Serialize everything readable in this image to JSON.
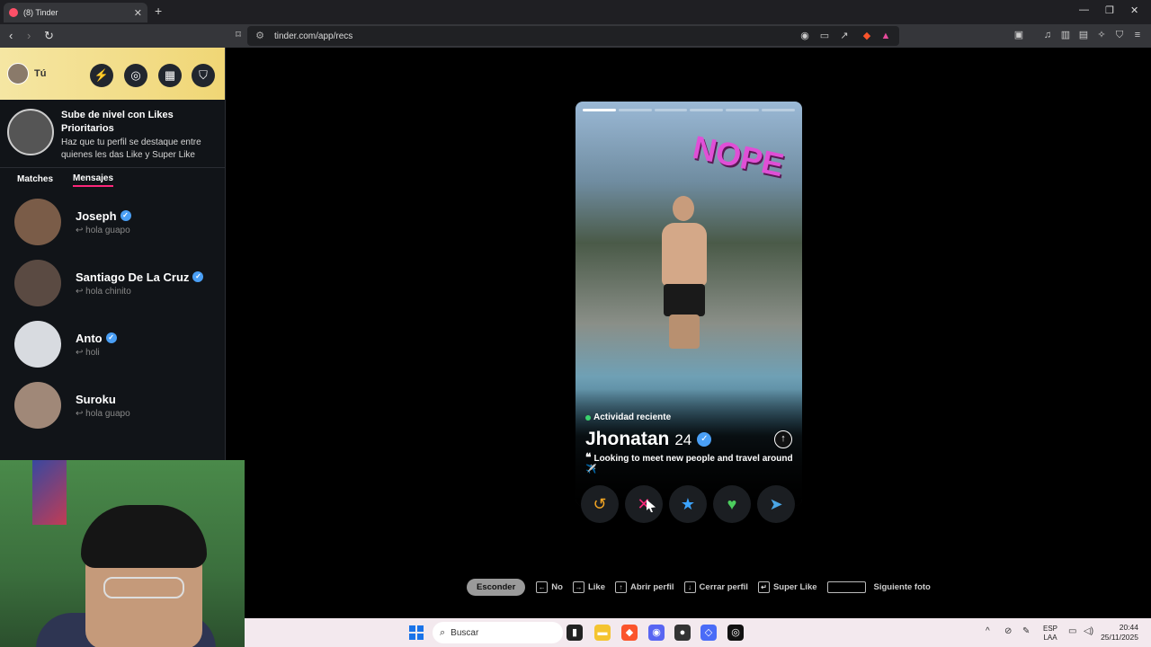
{
  "browser": {
    "tab_title": "(8) Tinder",
    "tab_close": "✕",
    "new_tab": "+",
    "url": "tinder.com/app/recs",
    "window_controls": [
      "—",
      "❐",
      "✕"
    ]
  },
  "sidebar": {
    "user_label": "Tú",
    "header_buttons": [
      "boost-icon",
      "explore-icon",
      "briefcase-icon",
      "shield-icon"
    ],
    "promo": {
      "title": "Sube de nivel con Likes Prioritarios",
      "description": "Haz que tu perfil se destaque entre quienes les das Like y Super Like"
    },
    "tabs": [
      {
        "label": "Matches",
        "active": false
      },
      {
        "label": "Mensajes",
        "active": true
      }
    ],
    "messages": [
      {
        "name": "Joseph",
        "verified": true,
        "preview": "hola guapo"
      },
      {
        "name": "Santiago De La Cruz",
        "verified": true,
        "preview": "hola chinito"
      },
      {
        "name": "Anto",
        "verified": true,
        "preview": "holi"
      },
      {
        "name": "Suroku",
        "verified": false,
        "preview": "hola guapo"
      }
    ]
  },
  "card": {
    "photo_count": 6,
    "active_photo": 1,
    "stamp": "NOPE",
    "activity": "Actividad reciente",
    "name": "Jhonatan",
    "age": "24",
    "verified": true,
    "bio": "Looking to meet new people and travel around ✈️"
  },
  "actions": [
    {
      "name": "rewind",
      "icon": "↺",
      "color": "#f5a623"
    },
    {
      "name": "nope",
      "icon": "✕",
      "color": "#fd267a"
    },
    {
      "name": "super-like",
      "icon": "★",
      "color": "#3ca4ff"
    },
    {
      "name": "like",
      "icon": "♥",
      "color": "#4ccd5e"
    },
    {
      "name": "boost",
      "icon": "➤",
      "color": "#4aa6e6"
    }
  ],
  "hints": {
    "hide": "Esconder",
    "items": [
      {
        "key": "←",
        "label": "No"
      },
      {
        "key": "→",
        "label": "Like"
      },
      {
        "key": "↑",
        "label": "Abrir perfil"
      },
      {
        "key": "↓",
        "label": "Cerrar perfil"
      },
      {
        "key": "↵",
        "label": "Super Like"
      },
      {
        "key": "",
        "label": "Siguiente foto"
      }
    ]
  },
  "taskbar": {
    "search_placeholder": "Buscar",
    "lang_top": "ESP",
    "lang_bottom": "LAA",
    "time": "20:44",
    "date": "25/11/2025"
  }
}
